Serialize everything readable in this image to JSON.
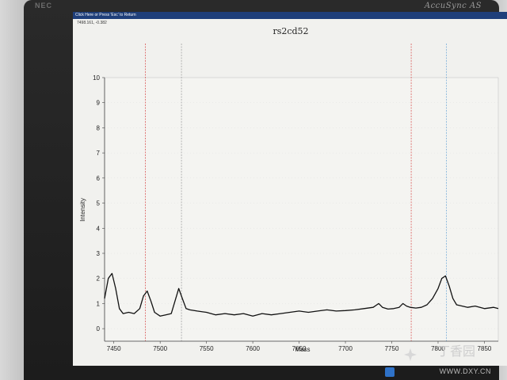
{
  "window": {
    "title_bar": "Click Here or Press 'Esc' to Return",
    "cursor_readout": "7498.161, -0.382"
  },
  "monitor": {
    "brand": "AccuSync AS",
    "logo": "NEC"
  },
  "watermark": {
    "site": "丁香园",
    "url": "WWW.DXY.CN"
  },
  "chart_data": {
    "type": "line",
    "title": "rs2cd52",
    "xlabel": "Mass",
    "ylabel": "Intensity",
    "xlim": [
      7440,
      7865
    ],
    "ylim": [
      -0.5,
      10
    ],
    "x_ticks": [
      7450,
      7500,
      7550,
      7600,
      7650,
      7700,
      7750,
      7800,
      7850
    ],
    "y_ticks": [
      0,
      1,
      2,
      3,
      4,
      5,
      6,
      7,
      8,
      9,
      10
    ],
    "markers": [
      {
        "x": 7484,
        "color": "#d64545"
      },
      {
        "x": 7523,
        "color": "#9a9a9a"
      },
      {
        "x": 7771,
        "color": "#d64545"
      },
      {
        "x": 7809,
        "color": "#6aa6d6"
      }
    ],
    "series": [
      {
        "color": "#111111",
        "x": [
          7440,
          7444,
          7448,
          7452,
          7456,
          7460,
          7466,
          7472,
          7478,
          7482,
          7486,
          7490,
          7494,
          7500,
          7506,
          7512,
          7516,
          7520,
          7524,
          7528,
          7532,
          7540,
          7550,
          7560,
          7570,
          7580,
          7590,
          7600,
          7610,
          7620,
          7630,
          7640,
          7650,
          7660,
          7670,
          7680,
          7690,
          7700,
          7710,
          7720,
          7730,
          7736,
          7740,
          7746,
          7752,
          7758,
          7762,
          7766,
          7770,
          7776,
          7782,
          7788,
          7794,
          7800,
          7804,
          7808,
          7812,
          7816,
          7820,
          7826,
          7832,
          7840,
          7850,
          7860,
          7865
        ],
        "y": [
          1.2,
          2.0,
          2.2,
          1.6,
          0.8,
          0.6,
          0.65,
          0.6,
          0.8,
          1.3,
          1.5,
          1.1,
          0.65,
          0.5,
          0.55,
          0.6,
          1.1,
          1.6,
          1.2,
          0.8,
          0.75,
          0.7,
          0.65,
          0.55,
          0.6,
          0.55,
          0.6,
          0.5,
          0.6,
          0.55,
          0.6,
          0.65,
          0.7,
          0.65,
          0.7,
          0.75,
          0.7,
          0.72,
          0.75,
          0.8,
          0.85,
          1.0,
          0.85,
          0.78,
          0.8,
          0.85,
          1.0,
          0.9,
          0.85,
          0.82,
          0.85,
          0.95,
          1.2,
          1.6,
          2.0,
          2.1,
          1.7,
          1.2,
          0.95,
          0.9,
          0.85,
          0.9,
          0.8,
          0.85,
          0.8
        ]
      }
    ]
  }
}
